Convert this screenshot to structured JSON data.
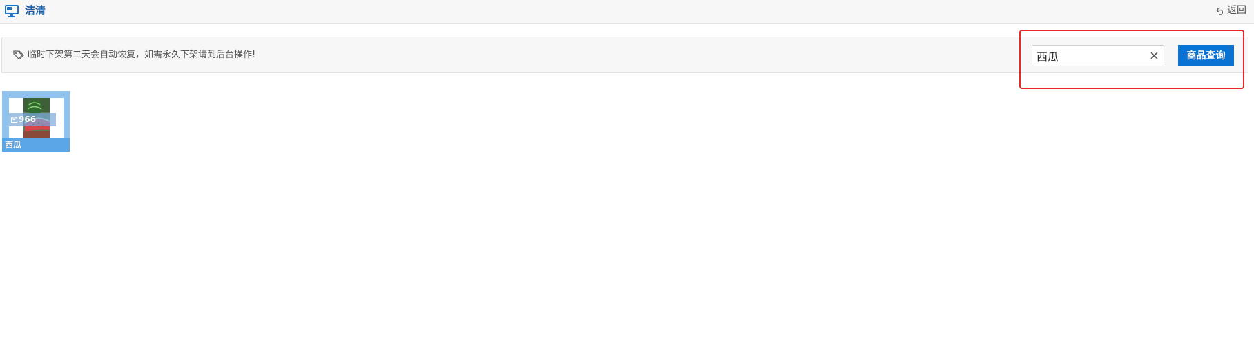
{
  "header": {
    "title": "洁清",
    "title_icon": "monitor-icon",
    "back_label": "返回",
    "back_icon": "undo-arrow-icon",
    "title_color": "#1a5fa8"
  },
  "notice": {
    "icon": "tag-icon",
    "text": "临时下架第二天会自动恢复，如需永久下架请到后台操作!"
  },
  "search": {
    "value": "西瓜",
    "clear_icon": "close-icon",
    "button_label": "商品查询",
    "button_color": "#0a72d2",
    "highlight_color": "#e8262b"
  },
  "products": [
    {
      "name": "西瓜",
      "stock": "966",
      "stock_icon": "box-icon",
      "image": "watermelon-photo"
    }
  ]
}
